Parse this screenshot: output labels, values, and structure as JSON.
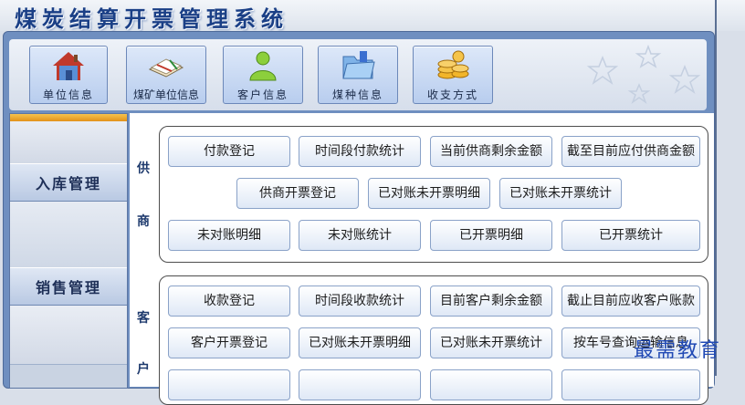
{
  "app": {
    "title": "煤炭结算开票管理系统"
  },
  "toolbar": {
    "items": [
      {
        "label": "单位信息",
        "icon": "house-icon"
      },
      {
        "label": "煤矿单位信息",
        "icon": "book-icon"
      },
      {
        "label": "客户信息",
        "icon": "user-icon"
      },
      {
        "label": "煤种信息",
        "icon": "folder-icon"
      },
      {
        "label": "收支方式",
        "icon": "coins-icon"
      }
    ]
  },
  "sidebar": {
    "items": [
      {
        "label": "入库管理"
      },
      {
        "label": "销售管理"
      }
    ]
  },
  "supplier": {
    "label_1": "供",
    "label_2": "商",
    "row1": [
      "付款登记",
      "时间段付款统计",
      "当前供商剩余金额",
      "截至目前应付供商金额"
    ],
    "row2": [
      "供商开票登记",
      "已对账未开票明细",
      "已对账未开票统计"
    ],
    "row3": [
      "未对账明细",
      "未对账统计",
      "已开票明细",
      "已开票统计"
    ]
  },
  "customer": {
    "label_1": "客",
    "label_2": "户",
    "row1": [
      "收款登记",
      "时间段收款统计",
      "目前客户剩余金额",
      "截止目前应收客户账款"
    ],
    "row2": [
      "客户开票登记",
      "已对账未开票明细",
      "已对账未开票统计",
      "按车号查询运输信息"
    ]
  },
  "watermark": {
    "text": "最需教育"
  },
  "colors": {
    "accent": "#1a3f86",
    "frame": "#6f8fc0",
    "sidebar_top": "#f0b434"
  }
}
